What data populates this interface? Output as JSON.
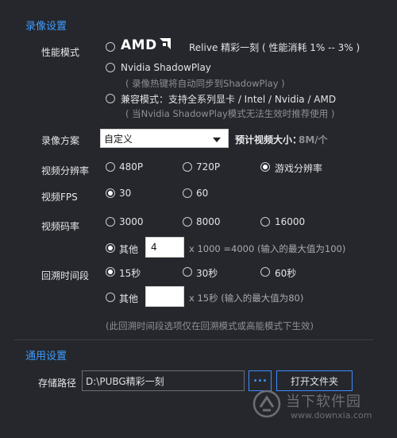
{
  "sections": {
    "recording": "录像设置",
    "general": "通用设置"
  },
  "performance_mode": {
    "label": "性能模式",
    "amd_brand": "AMD",
    "relive_text": "Relive 精彩一刻 ( 性能消耗 1% -- 3% )",
    "nvidia": "Nvidia ShadowPlay",
    "nvidia_note": "( 录像热键将自动同步到ShadowPlay )",
    "compat": "兼容模式：支持全系列显卡 / Intel / Nvidia / AMD",
    "compat_note": "( 当Nvidia ShadowPlay模式无法生效时推荐使用 )"
  },
  "scheme": {
    "label": "录像方案",
    "value": "自定义",
    "size_label": "预计视频大小：",
    "size_value": "8M/个"
  },
  "resolution": {
    "label": "视频分辨率",
    "options": [
      "480P",
      "720P",
      "游戏分辨率"
    ],
    "selected": 2
  },
  "fps": {
    "label": "视频FPS",
    "options": [
      "30",
      "60"
    ],
    "selected": 0
  },
  "bitrate": {
    "label": "视频码率",
    "options": [
      "3000",
      "8000",
      "16000"
    ],
    "other_label": "其他",
    "other_value": "4",
    "formula": "x 1000 =4000 (输入的最大值为100)"
  },
  "backtrack": {
    "label": "回溯时间段",
    "options": [
      "15秒",
      "30秒",
      "60秒"
    ],
    "other_label": "其他",
    "other_value": "",
    "formula": "x 15秒 (输入的最大值为80)",
    "note": "(此回溯时间段选项仅在回溯模式或高能模式下生效)"
  },
  "storage": {
    "label": "存储路径",
    "path": "D:\\PUBG精彩一刻",
    "browse": "•••",
    "open_folder": "打开文件夹"
  },
  "watermark": {
    "title": "当下软件园",
    "url": "www.downxia.com"
  },
  "colors": {
    "accent": "#3d9bff",
    "background": "#25272c"
  }
}
